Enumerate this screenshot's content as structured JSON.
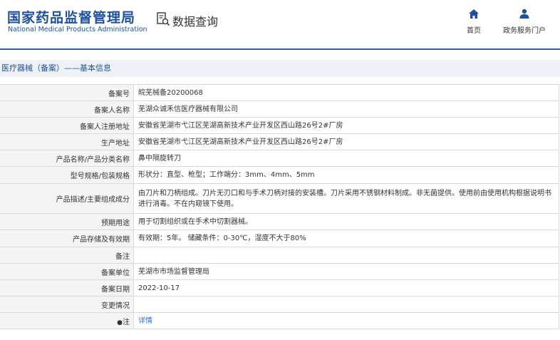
{
  "header": {
    "logo_cn": "国家药品监督管理局",
    "logo_en": "National Medical Products Administration",
    "query_label": "数据查询",
    "nav": [
      {
        "label": "首页",
        "icon": "home-icon"
      },
      {
        "label": "政务服务门户",
        "icon": "user-icon"
      }
    ]
  },
  "breadcrumb": "医疗器械（备案）——基本信息",
  "rows": [
    {
      "label": "备案号",
      "value": "皖芜械备20200068"
    },
    {
      "label": "备案人名称",
      "value": "芜湖众诚禾信医疗器械有限公司"
    },
    {
      "label": "备案人注册地址",
      "value": "安徽省芜湖市弋江区芜湖高新技术产业开发区西山路26号2#厂房"
    },
    {
      "label": "生产地址",
      "value": "安徽省芜湖市弋江区芜湖高新技术产业开发区西山路26号2#厂房"
    },
    {
      "label": "产品名称/产品分类名称",
      "value": "鼻中隔旋转刀"
    },
    {
      "label": "型号规格/包装规格",
      "value": "形状分：直型、枪型；工作端分：3mm、4mm、5mm"
    },
    {
      "label": "产品描述/主要组成成分",
      "value": "由刀片和刀柄组成。刀片无刃口和与手术刀柄对接的安装槽。刀片采用不锈钢材料制成。非无菌提供。使用前由使用机构根据说明书进行消毒。不在内窥镜下使用。"
    },
    {
      "label": "预期用途",
      "value": "用于切割组织或在手术中切割器械。"
    },
    {
      "label": "产品存储及有效期",
      "value": "有效期：5年。 储藏条件：0-30℃，湿度不大于80%"
    },
    {
      "label": "备注",
      "value": ""
    },
    {
      "label": "备案单位",
      "value": "芜湖市市场监督管理局"
    },
    {
      "label": "备案日期",
      "value": "2022-10-17"
    },
    {
      "label": "变更情况",
      "value": ""
    },
    {
      "label": "注",
      "value": "详情"
    }
  ]
}
